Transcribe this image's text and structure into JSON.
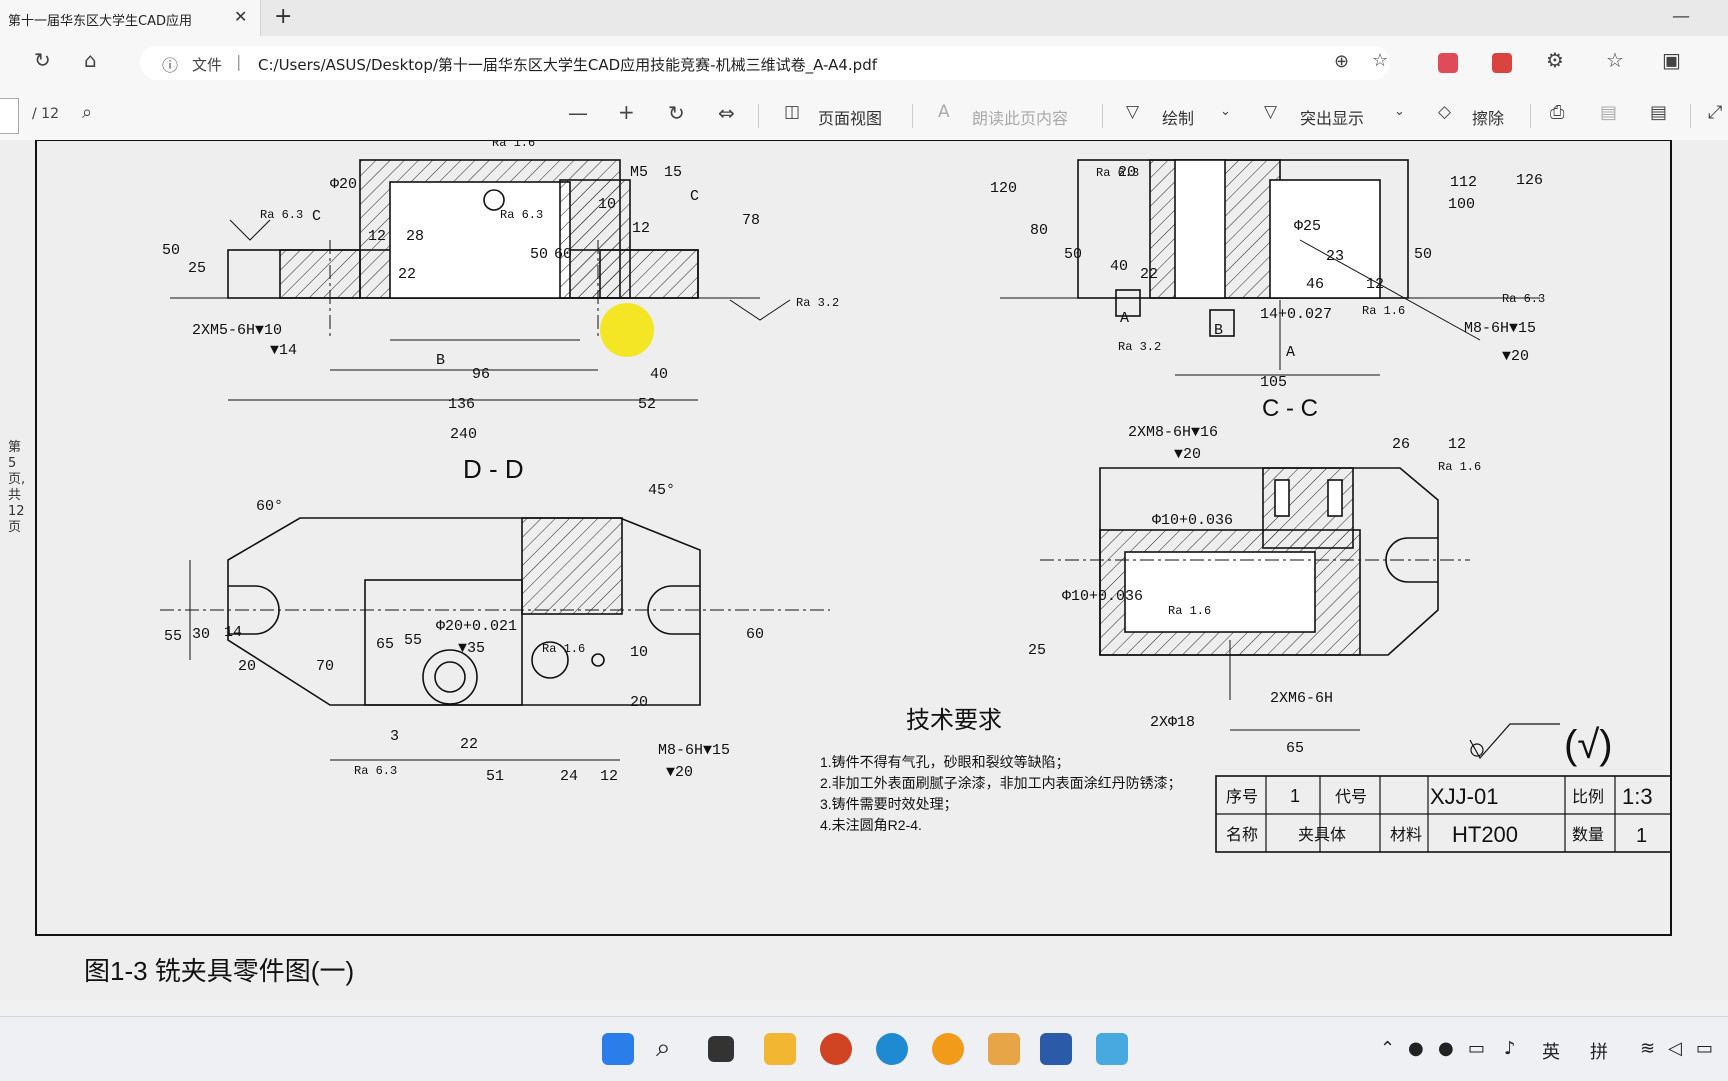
{
  "browser": {
    "tab_title": "第十一届华东区大学生CAD应用",
    "tab_close": "✕",
    "new_tab": "+",
    "minimize": "—",
    "info_label": "文件",
    "url": "C:/Users/ASUS/Desktop/第十一届华东区大学生CAD应用技能竞赛-机械三维试卷_A-A4.pdf"
  },
  "pdf_toolbar": {
    "page_count": "/ 12",
    "page_view": "页面视图",
    "read_aloud": "朗读此页内容",
    "draw": "绘制",
    "highlight": "突出显示",
    "erase": "擦除"
  },
  "sidebar_page_label": "第 5 页, 共 12 页",
  "drawing": {
    "caption": "图1-3 铣夹具零件图(一)",
    "section_cc": "C - C",
    "section_dd": "D - D",
    "tech_title": "技术要求",
    "tech_notes": [
      "1.铸件不得有气孔，砂眼和裂纹等缺陷；",
      "2.非加工外表面刷腻子涂漆，非加工内表面涂红丹防锈漆；",
      "3.铸件需要时效处理；",
      "4.未注圆角R2-4."
    ],
    "title_block": {
      "seq_label": "序号",
      "seq": "1",
      "code_label": "代号",
      "code": "XJJ-01",
      "scale_label": "比例",
      "scale": "1:3",
      "name_label": "名称",
      "name": "夹具体",
      "material_label": "材料",
      "material": "HT200",
      "qty_label": "数量",
      "qty": "1"
    },
    "dims_top_left": [
      "2XM5-6H▼10",
      "▼14",
      "Ra 6.3",
      "Ra 6.3",
      "Ra 1.6",
      "Ra 3.2",
      "50",
      "25",
      "12",
      "28",
      "22",
      "60",
      "50",
      "10",
      "12",
      "78",
      "M5",
      "15",
      "96",
      "40",
      "136",
      "52",
      "240",
      "B",
      "C",
      "C",
      "Φ20"
    ],
    "dims_top_right": [
      "120",
      "80",
      "50",
      "40",
      "22",
      "20",
      "Ra 6.3",
      "Φ25",
      "23",
      "46",
      "12",
      "100",
      "112",
      "126",
      "50",
      "Ra 6.3",
      "M8-6H▼15",
      "▼20",
      "14+0.027",
      "Ra 1.6",
      "105",
      "A",
      "A",
      "B",
      "Ra 3.2"
    ],
    "dims_dd": [
      "60°",
      "45°",
      "55",
      "30",
      "14",
      "20",
      "70",
      "65",
      "55",
      "Φ20+0.021",
      "▼35",
      "Ra 1.6",
      "60",
      "10",
      "20",
      "3",
      "22",
      "51",
      "24",
      "12",
      "M8-6H▼15",
      "▼20",
      "Ra 6.3"
    ],
    "dims_cc": [
      "2XM8-6H▼16",
      "▼20",
      "26",
      "12",
      "Ra 1.6",
      "Φ10+0.036",
      "Φ10+0.036",
      "Ra 1.6",
      "25",
      "2XM6-6H",
      "2XΦ18",
      "65"
    ],
    "roughness_note": "(√)"
  },
  "taskbar": {
    "tray_lang": "英",
    "tray_ime": "拼"
  }
}
